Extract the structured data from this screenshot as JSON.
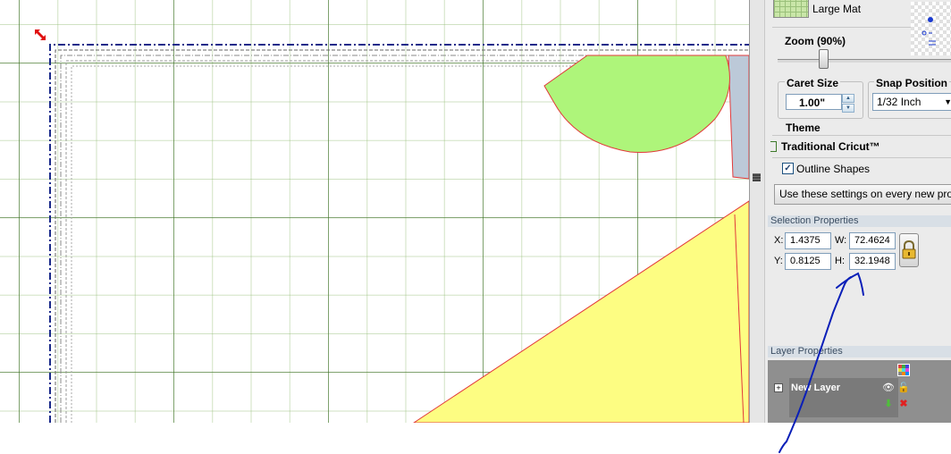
{
  "mat": {
    "label": "Large Mat"
  },
  "zoom": {
    "label": "Zoom (90%)",
    "level_percent": 90
  },
  "caret": {
    "title": "Caret Size",
    "value": "1.00\""
  },
  "snap": {
    "title": "Snap Position",
    "value": "1/32 Inch"
  },
  "theme": {
    "title": "Theme",
    "value": "Traditional Cricut™",
    "outline_label": "Outline Shapes",
    "outline_checked": true
  },
  "settings_button": {
    "label": "Use these settings on every new project"
  },
  "selection": {
    "header": "Selection Properties",
    "x_label": "X:",
    "x_value": "1.4375",
    "y_label": "Y:",
    "y_value": "0.8125",
    "w_label": "W:",
    "w_value": "72.4624",
    "h_label": "H:",
    "h_value": "32.1948"
  },
  "layers": {
    "header": "Layer Properties",
    "layer_name": "New Layer"
  },
  "icons": {
    "resize": "resize-arrow-icon",
    "lock": "padlock-icon",
    "eye": "eye-icon",
    "grid": "grid-icon",
    "down": "down-arrow-icon",
    "delete": "delete-x-icon"
  },
  "colors": {
    "shape_green": "#aef57a",
    "shape_yellow": "#fdfd82",
    "shape_outline": "#e23a3a",
    "annotation_ink": "#0a1fb8",
    "mat_border": "#1a2a8a"
  }
}
